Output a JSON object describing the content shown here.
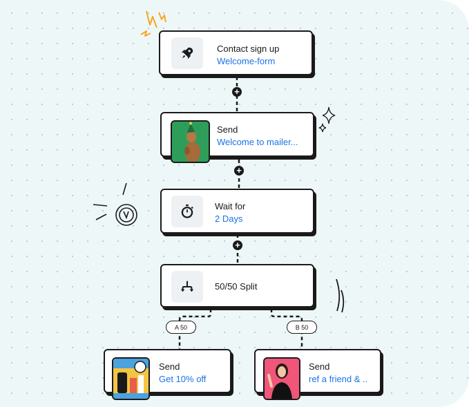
{
  "flow": {
    "trigger": {
      "title": "Contact sign up",
      "subtitle": "Welcome-form",
      "icon": "rocket-icon"
    },
    "send_welcome": {
      "title": "Send",
      "subtitle": "Welcome to mailer...",
      "thumbnail": "party-animal-photo"
    },
    "wait": {
      "title": "Wait for",
      "subtitle": "2 Days",
      "icon": "stopwatch-icon"
    },
    "split": {
      "title": "50/50 Split",
      "icon": "split-arrows-icon"
    },
    "branch_a": {
      "label": "A 50",
      "title": "Send",
      "subtitle": "Get 10% off",
      "thumbnail": "sale-graphic"
    },
    "branch_b": {
      "label": "B 50",
      "title": "Send",
      "subtitle": "ref a friend & ..",
      "thumbnail": "woman-pointing-photo"
    }
  },
  "add_step_symbol": "+",
  "colors": {
    "accent": "#1a73e8",
    "canvas": "#eef7f8",
    "outline": "#1a1a1a",
    "spark": "#f5a623"
  }
}
